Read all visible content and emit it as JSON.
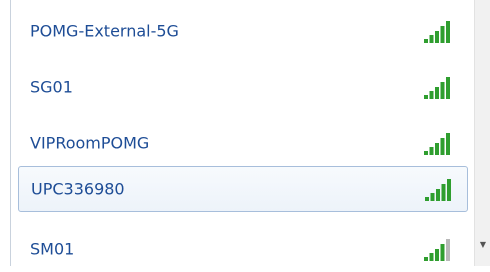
{
  "networks": [
    {
      "name": "POMG-External-5G",
      "signal": "full",
      "selected": false
    },
    {
      "name": "SG01",
      "signal": "full",
      "selected": false
    },
    {
      "name": "VIPRoomPOMG",
      "signal": "full",
      "selected": false
    },
    {
      "name": "UPC336980",
      "signal": "full",
      "selected": true
    },
    {
      "name": "SM01",
      "signal": "partial",
      "selected": false
    }
  ],
  "colors": {
    "label": "#1e4d96",
    "signal_on": "#2f9e2f",
    "signal_off": "#b8b8b8",
    "selected_border": "#a7bedb"
  },
  "scrollbar": {
    "down_arrow_icon": "chevron-down-icon",
    "glyph": "▼"
  }
}
